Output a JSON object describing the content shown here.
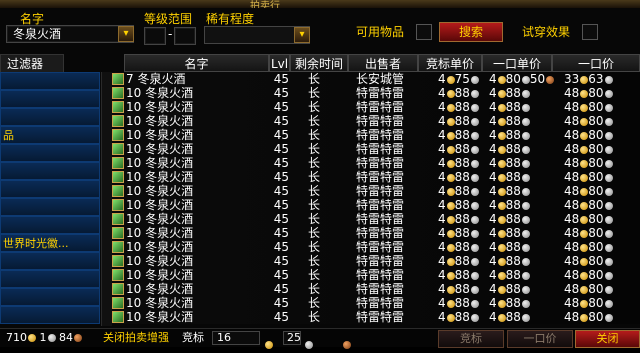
{
  "window": {
    "title": "拍卖行"
  },
  "search": {
    "name_label": "名字",
    "name_value": "冬泉火酒",
    "level_range_label": "等级范围",
    "level_min": "",
    "level_max": "",
    "rarity_label": "稀有程度",
    "usable_label": "可用物品",
    "search_button": "搜索",
    "try_on_label": "试穿效果"
  },
  "filters": {
    "tab_label": "过滤器",
    "items": [
      {
        "label": ""
      },
      {
        "label": ""
      },
      {
        "label": ""
      },
      {
        "label": "品"
      },
      {
        "label": ""
      },
      {
        "label": ""
      },
      {
        "label": ""
      },
      {
        "label": ""
      },
      {
        "label": ""
      },
      {
        "label": "世界时光徽..."
      },
      {
        "label": ""
      },
      {
        "label": ""
      },
      {
        "label": ""
      },
      {
        "label": ""
      }
    ]
  },
  "table": {
    "headers": {
      "name": "名字",
      "lvl": "Lvl",
      "time_left": "剩余时间",
      "seller": "出售者",
      "bid_unit": "竞标单价",
      "buyout_unit": "一口单价",
      "buyout": "一口价"
    },
    "rows": [
      {
        "qty": "7",
        "name": "冬泉火酒",
        "lvl": "45",
        "time": "长",
        "seller": "长安城管",
        "bid": "4",
        "bid_s": "75",
        "bo_unit_g": "4",
        "bo_unit_s": "80",
        "bo_unit_c": "50",
        "bo": "33",
        "bo_s": "63"
      },
      {
        "qty": "10",
        "name": "冬泉火酒",
        "lvl": "45",
        "time": "长",
        "seller": "特雷特雷",
        "bid": "4",
        "bid_s": "88",
        "bo_unit_g": "4",
        "bo_unit_s": "88",
        "bo_unit_c": "",
        "bo": "48",
        "bo_s": "80"
      },
      {
        "qty": "10",
        "name": "冬泉火酒",
        "lvl": "45",
        "time": "长",
        "seller": "特雷特雷",
        "bid": "4",
        "bid_s": "88",
        "bo_unit_g": "4",
        "bo_unit_s": "88",
        "bo_unit_c": "",
        "bo": "48",
        "bo_s": "80"
      },
      {
        "qty": "10",
        "name": "冬泉火酒",
        "lvl": "45",
        "time": "长",
        "seller": "特雷特雷",
        "bid": "4",
        "bid_s": "88",
        "bo_unit_g": "4",
        "bo_unit_s": "88",
        "bo_unit_c": "",
        "bo": "48",
        "bo_s": "80"
      },
      {
        "qty": "10",
        "name": "冬泉火酒",
        "lvl": "45",
        "time": "长",
        "seller": "特雷特雷",
        "bid": "4",
        "bid_s": "88",
        "bo_unit_g": "4",
        "bo_unit_s": "88",
        "bo_unit_c": "",
        "bo": "48",
        "bo_s": "80"
      },
      {
        "qty": "10",
        "name": "冬泉火酒",
        "lvl": "45",
        "time": "长",
        "seller": "特雷特雷",
        "bid": "4",
        "bid_s": "88",
        "bo_unit_g": "4",
        "bo_unit_s": "88",
        "bo_unit_c": "",
        "bo": "48",
        "bo_s": "80"
      },
      {
        "qty": "10",
        "name": "冬泉火酒",
        "lvl": "45",
        "time": "长",
        "seller": "特雷特雷",
        "bid": "4",
        "bid_s": "88",
        "bo_unit_g": "4",
        "bo_unit_s": "88",
        "bo_unit_c": "",
        "bo": "48",
        "bo_s": "80"
      },
      {
        "qty": "10",
        "name": "冬泉火酒",
        "lvl": "45",
        "time": "长",
        "seller": "特雷特雷",
        "bid": "4",
        "bid_s": "88",
        "bo_unit_g": "4",
        "bo_unit_s": "88",
        "bo_unit_c": "",
        "bo": "48",
        "bo_s": "80"
      },
      {
        "qty": "10",
        "name": "冬泉火酒",
        "lvl": "45",
        "time": "长",
        "seller": "特雷特雷",
        "bid": "4",
        "bid_s": "88",
        "bo_unit_g": "4",
        "bo_unit_s": "88",
        "bo_unit_c": "",
        "bo": "48",
        "bo_s": "80"
      },
      {
        "qty": "10",
        "name": "冬泉火酒",
        "lvl": "45",
        "time": "长",
        "seller": "特雷特雷",
        "bid": "4",
        "bid_s": "88",
        "bo_unit_g": "4",
        "bo_unit_s": "88",
        "bo_unit_c": "",
        "bo": "48",
        "bo_s": "80"
      },
      {
        "qty": "10",
        "name": "冬泉火酒",
        "lvl": "45",
        "time": "长",
        "seller": "特雷特雷",
        "bid": "4",
        "bid_s": "88",
        "bo_unit_g": "4",
        "bo_unit_s": "88",
        "bo_unit_c": "",
        "bo": "48",
        "bo_s": "80"
      },
      {
        "qty": "10",
        "name": "冬泉火酒",
        "lvl": "45",
        "time": "长",
        "seller": "特雷特雷",
        "bid": "4",
        "bid_s": "88",
        "bo_unit_g": "4",
        "bo_unit_s": "88",
        "bo_unit_c": "",
        "bo": "48",
        "bo_s": "80"
      },
      {
        "qty": "10",
        "name": "冬泉火酒",
        "lvl": "45",
        "time": "长",
        "seller": "特雷特雷",
        "bid": "4",
        "bid_s": "88",
        "bo_unit_g": "4",
        "bo_unit_s": "88",
        "bo_unit_c": "",
        "bo": "48",
        "bo_s": "80"
      },
      {
        "qty": "10",
        "name": "冬泉火酒",
        "lvl": "45",
        "time": "长",
        "seller": "特雷特雷",
        "bid": "4",
        "bid_s": "88",
        "bo_unit_g": "4",
        "bo_unit_s": "88",
        "bo_unit_c": "",
        "bo": "48",
        "bo_s": "80"
      },
      {
        "qty": "10",
        "name": "冬泉火酒",
        "lvl": "45",
        "time": "长",
        "seller": "特雷特雷",
        "bid": "4",
        "bid_s": "88",
        "bo_unit_g": "4",
        "bo_unit_s": "88",
        "bo_unit_c": "",
        "bo": "48",
        "bo_s": "80"
      },
      {
        "qty": "10",
        "name": "冬泉火酒",
        "lvl": "45",
        "time": "长",
        "seller": "特雷特雷",
        "bid": "4",
        "bid_s": "88",
        "bo_unit_g": "4",
        "bo_unit_s": "88",
        "bo_unit_c": "",
        "bo": "48",
        "bo_s": "80"
      },
      {
        "qty": "10",
        "name": "冬泉火酒",
        "lvl": "45",
        "time": "长",
        "seller": "特雷特雷",
        "bid": "4",
        "bid_s": "88",
        "bo_unit_g": "4",
        "bo_unit_s": "88",
        "bo_unit_c": "",
        "bo": "48",
        "bo_s": "80"
      },
      {
        "qty": "10",
        "name": "冬泉火酒",
        "lvl": "45",
        "time": "长",
        "seller": "特雷特雷",
        "bid": "4",
        "bid_s": "88",
        "bo_unit_g": "4",
        "bo_unit_s": "88",
        "bo_unit_c": "",
        "bo": "48",
        "bo_s": "80"
      }
    ]
  },
  "bottom": {
    "money_gold": "710",
    "money_silver": "1",
    "money_copper": "84",
    "close_auctions": "关闭拍卖增强",
    "bid_label": "竞标",
    "bid_gold": "16",
    "bid_silver": "25",
    "bid_button": "竞标",
    "buyout_button": "一口价",
    "close_button": "关闭"
  },
  "colors": {
    "accent_gold": "#ffd100",
    "button_red": "#b51b1b",
    "filter_blue": "#0a2b55"
  }
}
